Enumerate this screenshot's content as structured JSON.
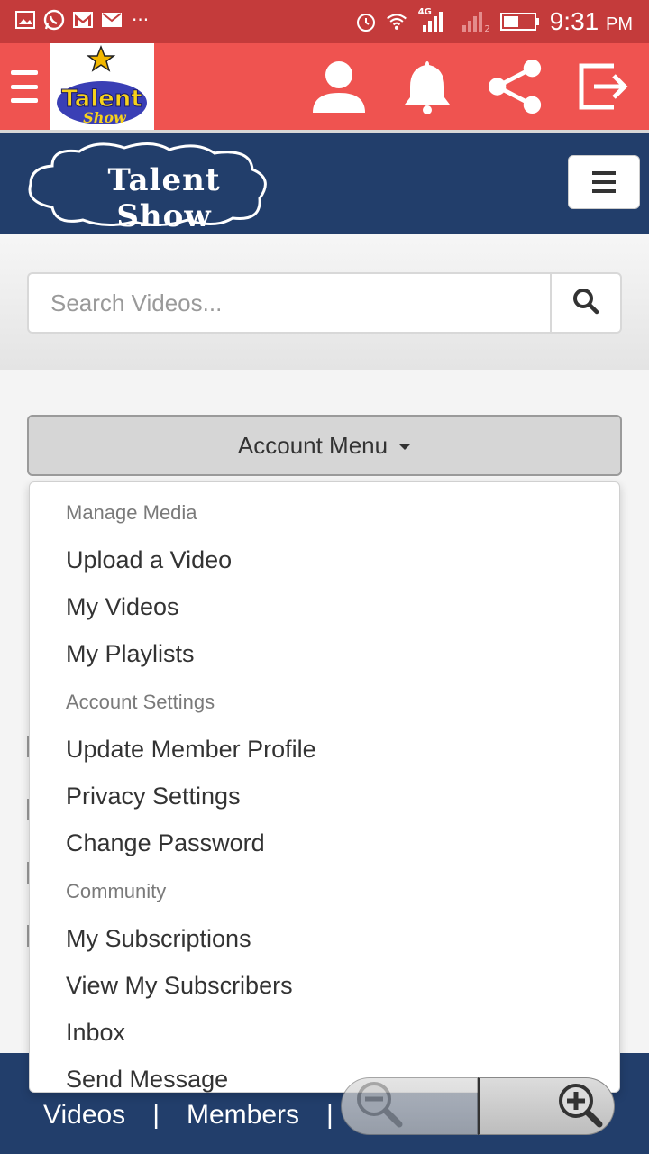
{
  "status_bar": {
    "icons": [
      "gallery-icon",
      "whatsapp-icon",
      "gmail-icon",
      "email-icon",
      "more-icon",
      "alarm-icon",
      "wifi-icon",
      "signal-icon"
    ],
    "network_label": "4G",
    "sim_label": "2",
    "overflow": "···",
    "time": "9:31",
    "time_suffix": "PM"
  },
  "app_bar": {
    "logo_text": "Talent",
    "logo_subtext": "Show",
    "icons": [
      "user-icon",
      "bell-icon",
      "share-icon",
      "logout-icon"
    ]
  },
  "site_header": {
    "logo_text": "Talent Show"
  },
  "search": {
    "placeholder": "Search Videos..."
  },
  "account_menu": {
    "label": "Account Menu",
    "sections": [
      {
        "header": "Manage Media",
        "items": [
          "Upload a Video",
          "My Videos",
          "My Playlists"
        ]
      },
      {
        "header": "Account Settings",
        "items": [
          "Update Member Profile",
          "Privacy Settings",
          "Change Password"
        ]
      },
      {
        "header": "Community",
        "items": [
          "My Subscriptions",
          "View My Subscribers",
          "Inbox",
          "Send Message"
        ]
      }
    ]
  },
  "footer": {
    "links": [
      "Videos",
      "|",
      "Members",
      "|"
    ]
  },
  "colors": {
    "status_bar": "#c43b3b",
    "app_bar": "#ef5350",
    "site_header": "#223e6b"
  }
}
